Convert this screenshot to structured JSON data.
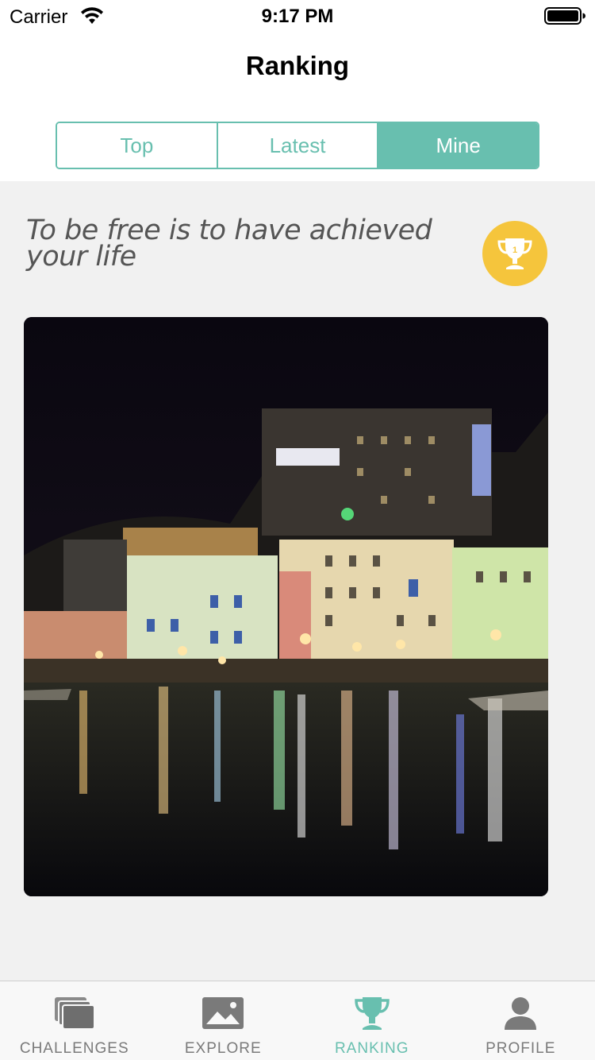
{
  "status_bar": {
    "carrier": "Carrier",
    "time": "9:17 PM"
  },
  "nav": {
    "title": "Ranking"
  },
  "segments": [
    {
      "label": "Top",
      "active": false
    },
    {
      "label": "Latest",
      "active": false
    },
    {
      "label": "Mine",
      "active": true
    }
  ],
  "challenge": {
    "title": "To be free is to have achieved your life",
    "badge_icon": "trophy-icon",
    "badge_rank": "1"
  },
  "photo": {
    "subject": "night harbor scene"
  },
  "tab_bar": {
    "items": [
      {
        "label": "CHALLENGES",
        "icon": "challenges-icon",
        "active": false
      },
      {
        "label": "EXPLORE",
        "icon": "image-icon",
        "active": false
      },
      {
        "label": "RANKING",
        "icon": "trophy-icon",
        "active": true
      },
      {
        "label": "PROFILE",
        "icon": "person-icon",
        "active": false
      }
    ]
  },
  "colors": {
    "accent": "#68bfaf",
    "badge": "#f5c53c",
    "content_bg": "#f1f1f1",
    "inactive_tab": "#7a7a7a"
  }
}
